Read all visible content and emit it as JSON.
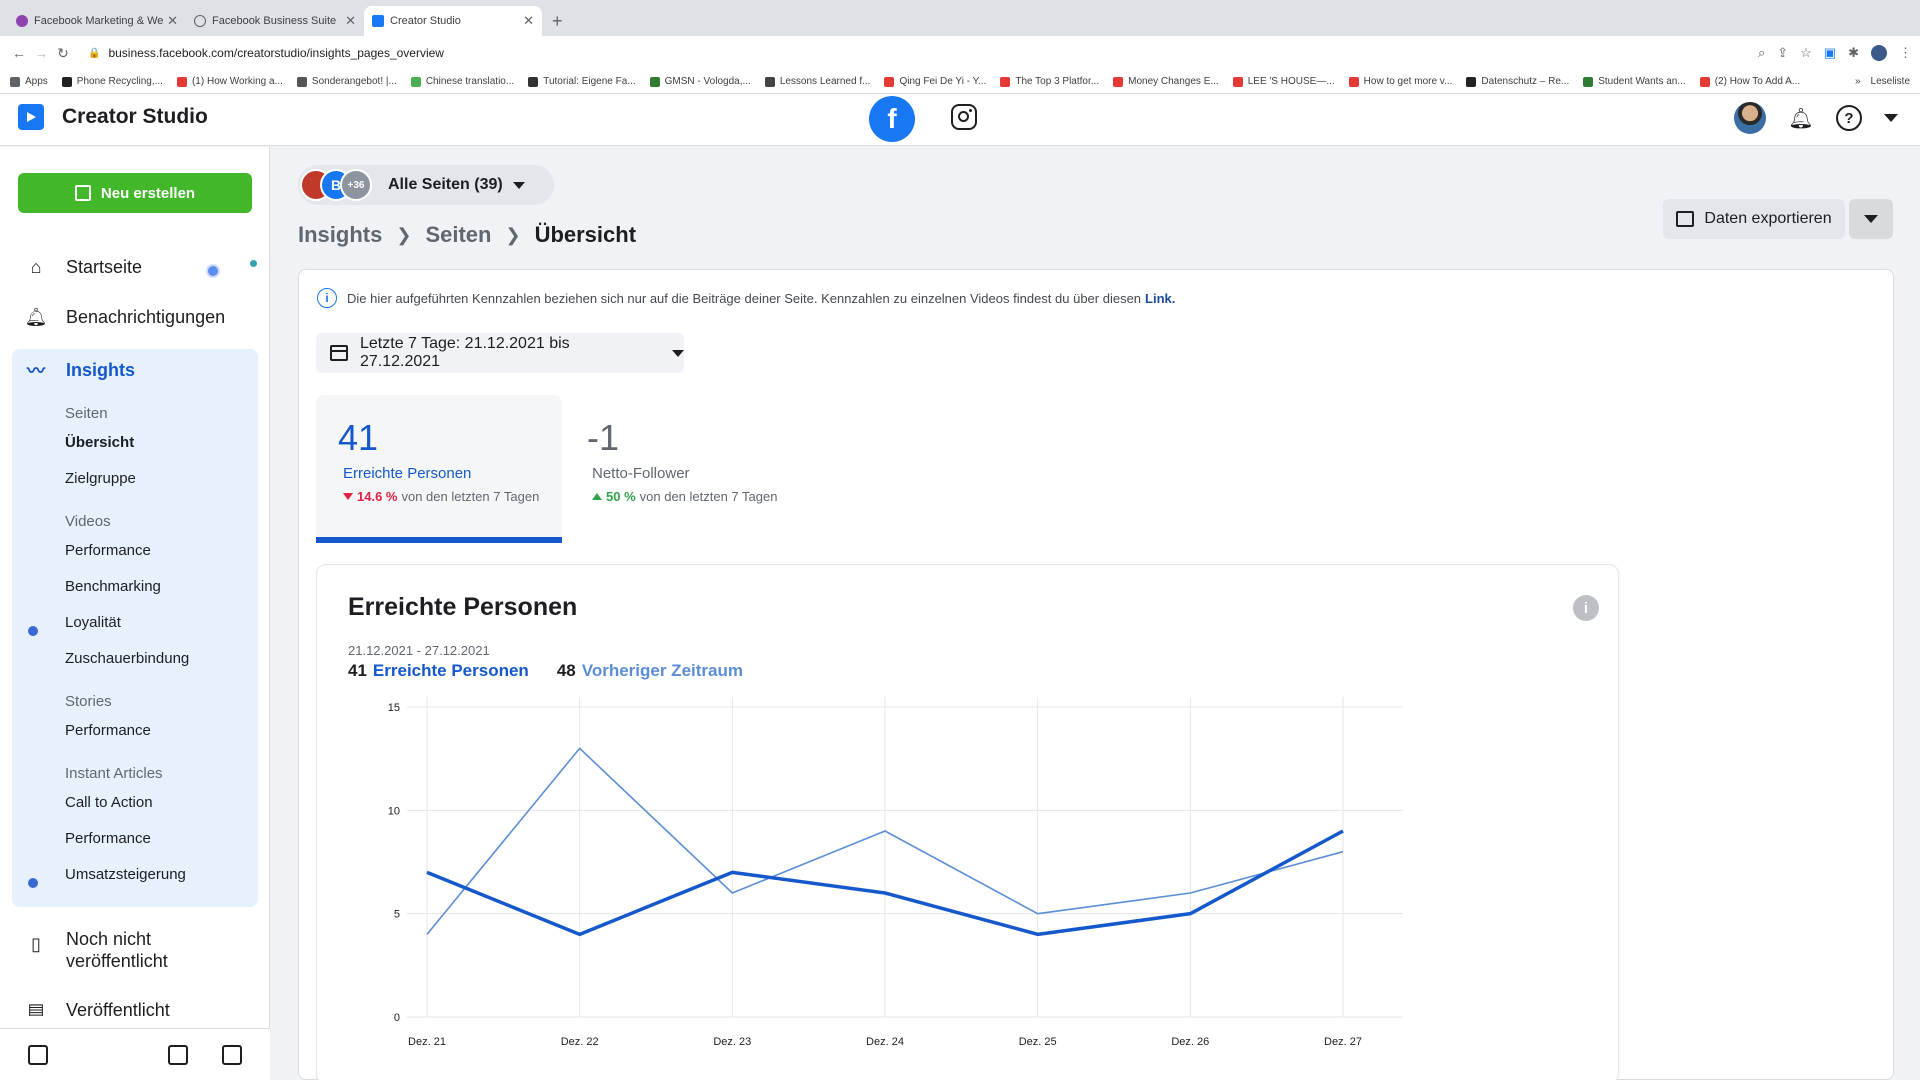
{
  "browser": {
    "tabs": [
      {
        "label": "Facebook Marketing & Werbe...",
        "color": "#8e44ad",
        "active": false
      },
      {
        "label": "Facebook Business Suite",
        "color": "#ffffff",
        "active": false
      },
      {
        "label": "Creator Studio",
        "color": "#1877f2",
        "active": true
      }
    ],
    "url": "business.facebook.com/creatorstudio/insights_pages_overview",
    "bookmarks": [
      {
        "label": "Apps",
        "color": "#5f6368"
      },
      {
        "label": "Phone Recycling,...",
        "color": "#202124"
      },
      {
        "label": "(1) How Working a...",
        "color": "#e53935"
      },
      {
        "label": "Sonderangebot! |...",
        "color": "#555555"
      },
      {
        "label": "Chinese translatio...",
        "color": "#4caf50"
      },
      {
        "label": "Tutorial: Eigene Fa...",
        "color": "#333333"
      },
      {
        "label": "GMSN - Vologda,...",
        "color": "#2e7d32"
      },
      {
        "label": "Lessons Learned f...",
        "color": "#444444"
      },
      {
        "label": "Qing Fei De Yi - Y...",
        "color": "#e53935"
      },
      {
        "label": "The Top 3 Platfor...",
        "color": "#e53935"
      },
      {
        "label": "Money Changes E...",
        "color": "#e53935"
      },
      {
        "label": "LEE 'S HOUSE—...",
        "color": "#e53935"
      },
      {
        "label": "How to get more v...",
        "color": "#e53935"
      },
      {
        "label": "Datenschutz – Re...",
        "color": "#222222"
      },
      {
        "label": "Student Wants an...",
        "color": "#2e7d32"
      },
      {
        "label": "(2) How To Add A...",
        "color": "#e53935"
      }
    ],
    "reading_list": "Leseliste"
  },
  "header": {
    "title": "Creator Studio"
  },
  "sidebar": {
    "create_button": "Neu erstellen",
    "items": {
      "home": "Startseite",
      "notifications": "Benachrichtigungen",
      "insights": "Insights",
      "unpublished": "Noch nicht veröffentlicht",
      "published": "Veröffentlicht"
    },
    "insights_sub": {
      "pages_head": "Seiten",
      "overview": "Übersicht",
      "audience": "Zielgruppe",
      "videos_head": "Videos",
      "video_performance": "Performance",
      "benchmarking": "Benchmarking",
      "loyalty": "Loyalität",
      "retention": "Zuschauerbindung",
      "stories_head": "Stories",
      "stories_performance": "Performance",
      "ia_head": "Instant Articles",
      "cta": "Call to Action",
      "ia_performance": "Performance",
      "revenue": "Umsatzsteigerung"
    }
  },
  "main": {
    "page_selector": {
      "label": "Alle Seiten (39)",
      "avatar_b": "B",
      "avatar_count": "+36"
    },
    "breadcrumb": {
      "insights": "Insights",
      "pages": "Seiten",
      "current": "Übersicht"
    },
    "export_button": "Daten exportieren",
    "notice": {
      "text": "Die hier aufgeführten Kennzahlen beziehen sich nur auf die Beiträge deiner Seite. Kennzahlen zu einzelnen Videos findest du über diesen",
      "link": "Link."
    },
    "date_range": "Letzte 7 Tage: 21.12.2021 bis 27.12.2021",
    "metrics": [
      {
        "value": "41",
        "label": "Erreichte Personen",
        "delta": "14.6 %",
        "delta_text": "von den letzten 7 Tagen",
        "direction": "down"
      },
      {
        "value": "-1",
        "label": "Netto-Follower",
        "delta": "50 %",
        "delta_text": "von den letzten 7 Tagen",
        "direction": "up"
      }
    ],
    "chart_card": {
      "title": "Erreichte Personen",
      "daterange": "21.12.2021 - 27.12.2021",
      "current_total": "41",
      "current_label": "Erreichte Personen",
      "previous_total": "48",
      "previous_label": "Vorheriger Zeitraum"
    }
  },
  "colors": {
    "accent": "#1458cc",
    "previous_line": "#5b8ed6",
    "create_green": "#42b72a",
    "down": "#e41e3f",
    "up": "#31a24c"
  },
  "chart_data": {
    "type": "line",
    "categories": [
      "Dez. 21",
      "Dez. 22",
      "Dez. 23",
      "Dez. 24",
      "Dez. 25",
      "Dez. 26",
      "Dez. 27"
    ],
    "series": [
      {
        "name": "Erreichte Personen",
        "values": [
          7,
          4,
          7,
          6,
          4,
          5,
          9
        ]
      },
      {
        "name": "Vorheriger Zeitraum",
        "values": [
          4,
          13,
          6,
          9,
          5,
          6,
          8
        ]
      }
    ],
    "yticks": [
      0,
      5,
      10,
      15
    ],
    "ylim": [
      0,
      15
    ],
    "grid": true
  }
}
